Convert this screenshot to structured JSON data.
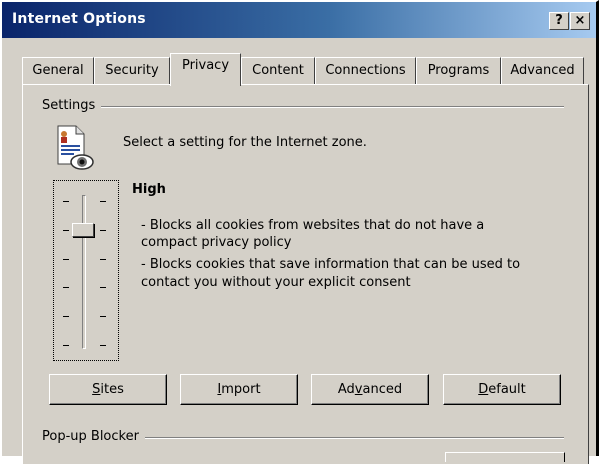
{
  "window": {
    "title": "Internet Options",
    "help_glyph": "?",
    "close_glyph": "×"
  },
  "tabs": [
    {
      "label": "General"
    },
    {
      "label": "Security"
    },
    {
      "label": "Privacy",
      "active": true
    },
    {
      "label": "Content"
    },
    {
      "label": "Connections"
    },
    {
      "label": "Programs"
    },
    {
      "label": "Advanced"
    }
  ],
  "settings": {
    "group_label": "Settings",
    "zone_text": "Select a setting for the Internet zone.",
    "icon": "privacy-document-eye-icon",
    "level": {
      "title": "High",
      "lines": [
        "- Blocks all cookies from websites that do not have a",
        "compact privacy policy",
        "- Blocks cookies that save information that can be used to",
        "contact you without your explicit consent"
      ]
    },
    "slider": {
      "positions": 6,
      "selected_index": 1
    }
  },
  "buttons": {
    "sites": {
      "pre": "",
      "accel": "S",
      "post": "ites"
    },
    "import": {
      "pre": "",
      "accel": "I",
      "post": "mport"
    },
    "advanced": {
      "pre": "Ad",
      "accel": "v",
      "post": "anced"
    },
    "default": {
      "pre": "",
      "accel": "D",
      "post": "efault"
    }
  },
  "popup": {
    "group_label": "Pop-up Blocker"
  }
}
